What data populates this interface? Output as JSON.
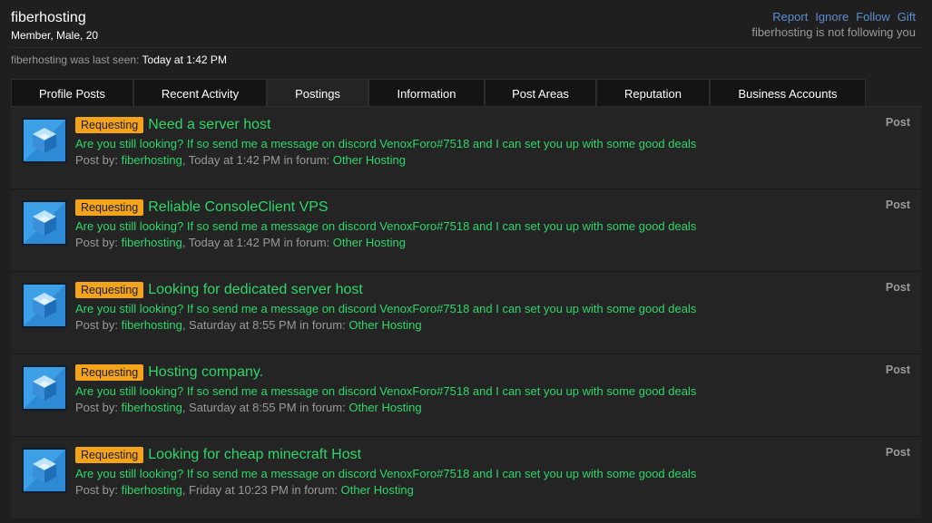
{
  "profile": {
    "username": "fiberhosting",
    "member_info": "Member, Male, 20",
    "last_seen_prefix": "fiberhosting was last seen:",
    "last_seen_value": "Today at 1:42 PM"
  },
  "actions": {
    "report": "Report",
    "ignore": "Ignore",
    "follow": "Follow",
    "gift": "Gift",
    "follow_status": "fiberhosting is not following you"
  },
  "tabs": [
    {
      "label": "Profile Posts",
      "active": false
    },
    {
      "label": "Recent Activity",
      "active": false
    },
    {
      "label": "Postings",
      "active": true
    },
    {
      "label": "Information",
      "active": false
    },
    {
      "label": "Post Areas",
      "active": false
    },
    {
      "label": "Reputation",
      "active": false
    },
    {
      "label": "Business Accounts",
      "active": false
    }
  ],
  "posts": [
    {
      "badge": "Requesting",
      "title": "Need a server host",
      "snippet": "Are you still looking? If so send me a message on discord VenoxForo#7518 and I can set you up with some good deals",
      "by_label": "Post by:",
      "author": "fiberhosting",
      "time": ", Today at 1:42 PM in forum:",
      "forum": "Other Hosting",
      "type": "Post"
    },
    {
      "badge": "Requesting",
      "title": "Reliable ConsoleClient VPS",
      "snippet": "Are you still looking? If so send me a message on discord VenoxForo#7518 and I can set you up with some good deals",
      "by_label": "Post by:",
      "author": "fiberhosting",
      "time": ", Today at 1:42 PM in forum:",
      "forum": "Other Hosting",
      "type": "Post"
    },
    {
      "badge": "Requesting",
      "title": "Looking for dedicated server host",
      "snippet": "Are you still looking? If so send me a message on discord VenoxForo#7518 and I can set you up with some good deals",
      "by_label": "Post by:",
      "author": "fiberhosting",
      "time": ", Saturday at 8:55 PM in forum:",
      "forum": "Other Hosting",
      "type": "Post"
    },
    {
      "badge": "Requesting",
      "title": "Hosting company.",
      "snippet": "Are you still looking? If so send me a message on discord VenoxForo#7518 and I can set you up with some good deals",
      "by_label": "Post by:",
      "author": "fiberhosting",
      "time": ", Saturday at 8:55 PM in forum:",
      "forum": "Other Hosting",
      "type": "Post"
    },
    {
      "badge": "Requesting",
      "title": "Looking for cheap minecraft Host",
      "snippet": "Are you still looking? If so send me a message on discord VenoxForo#7518 and I can set you up with some good deals",
      "by_label": "Post by:",
      "author": "fiberhosting",
      "time": ", Friday at 10:23 PM in forum:",
      "forum": "Other Hosting",
      "type": "Post"
    }
  ]
}
